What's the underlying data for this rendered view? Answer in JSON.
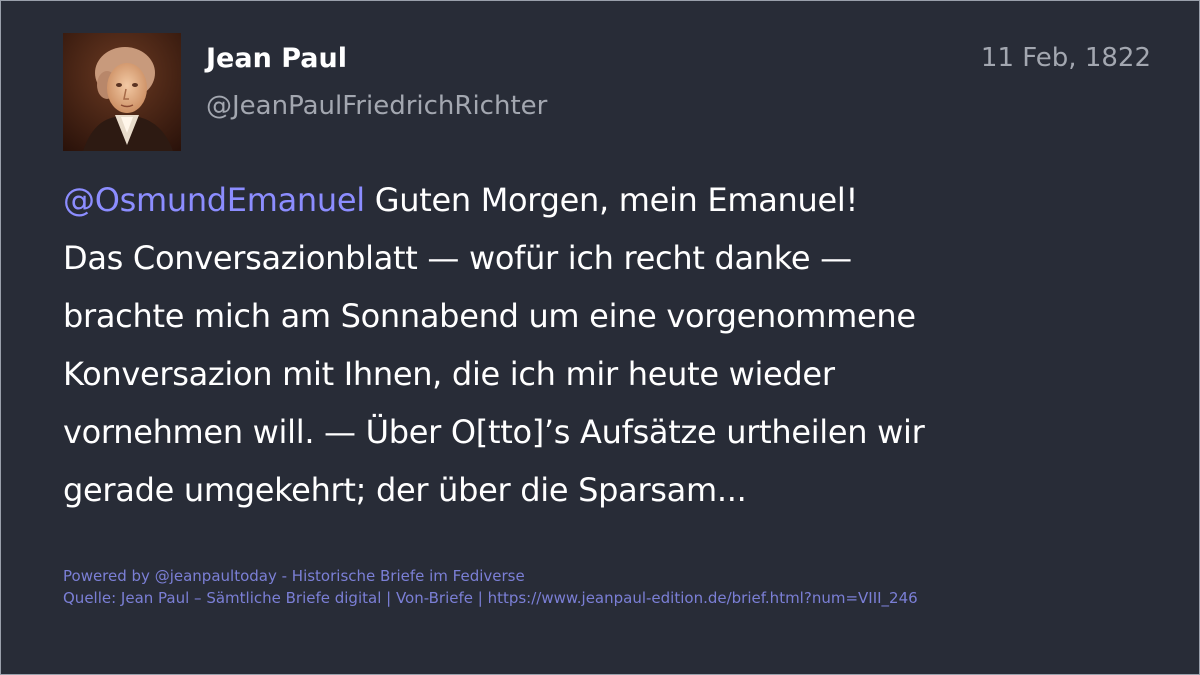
{
  "post": {
    "author": {
      "name": "Jean Paul",
      "handle": "@JeanPaulFriedrichRichter",
      "avatar_icon": "portrait-avatar"
    },
    "date": "11 Feb, 1822",
    "mention": "@OsmundEmanuel",
    "lines": [
      " Guten Morgen, mein Emanuel!",
      "Das Conversazionblatt — wofür ich recht danke —",
      "brachte mich am Sonnabend um eine vorgenommene",
      "Konversazion mit Ihnen, die ich mir heute wieder",
      "vornehmen will. — Über O[tto]’s Aufsätze urtheilen wir",
      "gerade umgekehrt; der über die Sparsam..."
    ]
  },
  "footer": {
    "powered_by": "Powered by @jeanpaultoday - Historische Briefe im Fediverse",
    "source": "Quelle: Jean Paul – Sämtliche Briefe digital | Von-Briefe | https://www.jeanpaul-edition.de/brief.html?num=VIII_246"
  },
  "colors": {
    "background": "#282c37",
    "mention": "#8c8dff",
    "footer_text": "#7b7fd6",
    "secondary_text": "#a3a7b0"
  }
}
